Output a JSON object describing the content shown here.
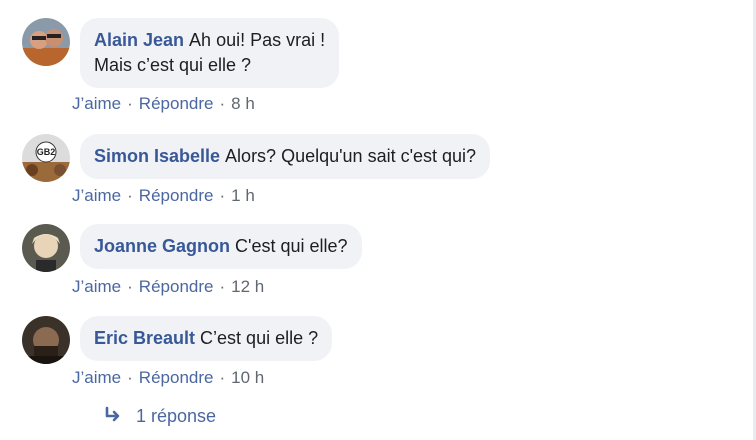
{
  "comments": [
    {
      "author": "Alain Jean",
      "text_line1": "Ah oui! Pas vrai !",
      "text_line2": "Mais c’est qui elle ?",
      "like": "J’aime",
      "reply": "Répondre",
      "time": "8 h",
      "sep": "·"
    },
    {
      "author": "Simon Isabelle",
      "text_line1": "Alors? Quelqu'un sait c'est qui?",
      "like": "J’aime",
      "reply": "Répondre",
      "time": "1 h",
      "sep": "·"
    },
    {
      "author": "Joanne Gagnon",
      "text_line1": "C'est qui elle?",
      "like": "J’aime",
      "reply": "Répondre",
      "time": "12 h",
      "sep": "·"
    },
    {
      "author": "Eric Breault",
      "text_line1": "C’est qui elle ?",
      "like": "J’aime",
      "reply": "Répondre",
      "time": "10 h",
      "sep": "·"
    }
  ],
  "replies": {
    "label": "1 réponse",
    "icon": "reply-arrow-icon"
  },
  "colors": {
    "author": "#385898",
    "link": "#4b67a1",
    "bubble": "#f0f2f5",
    "meta": "#606770"
  }
}
